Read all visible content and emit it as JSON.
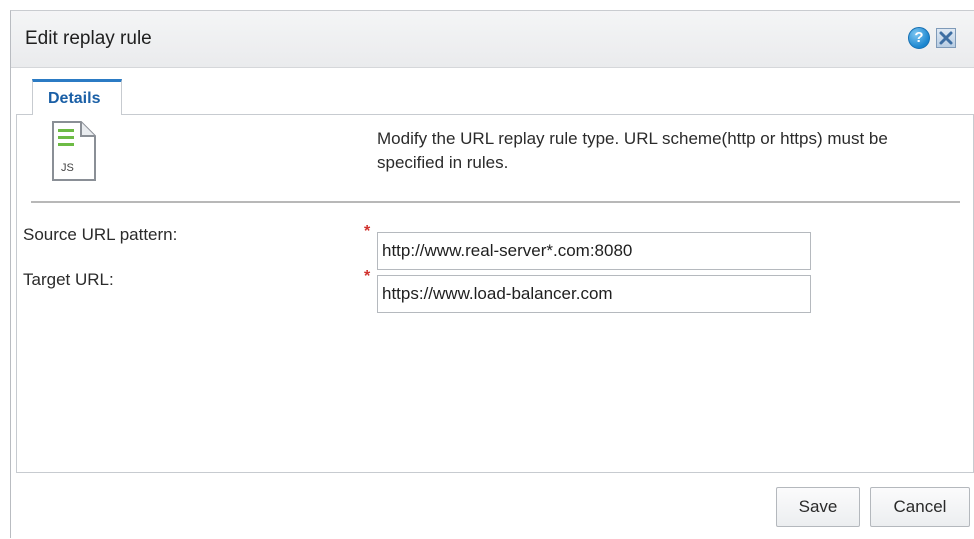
{
  "dialog": {
    "title": "Edit replay rule",
    "help_icon": "help-icon",
    "help_glyph": "?",
    "close_icon": "close-icon"
  },
  "tabs": [
    {
      "label": "Details",
      "active": true
    }
  ],
  "details": {
    "file_icon": "js-file-icon",
    "file_icon_text": "JS",
    "description": "Modify the URL replay rule type. URL scheme(http or https) must be specified in rules.",
    "fields": [
      {
        "label": "Source URL pattern:",
        "required_mark": "*",
        "value": "http://www.real-server*.com:8080"
      },
      {
        "label": "Target URL:",
        "required_mark": "*",
        "value": "https://www.load-balancer.com"
      }
    ]
  },
  "footer": {
    "save_label": "Save",
    "cancel_label": "Cancel"
  },
  "colors": {
    "tab_accent": "#2b7bc4",
    "tab_label": "#1a5fa6",
    "required": "#d0312d",
    "help_icon": "#1c86cf"
  }
}
